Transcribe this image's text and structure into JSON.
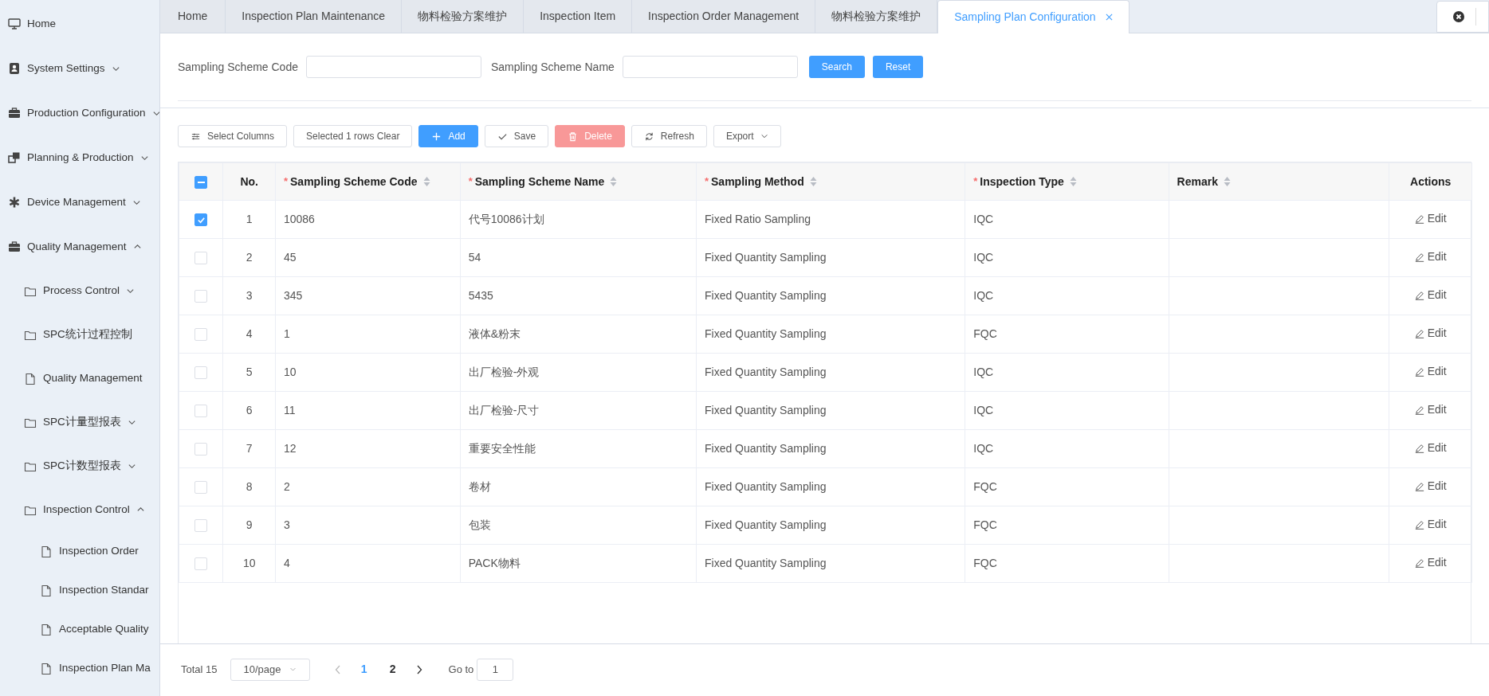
{
  "sidebar": {
    "items": [
      {
        "label": "Home",
        "kind": "menu"
      },
      {
        "label": "System Settings",
        "kind": "menu",
        "expanded": false
      },
      {
        "label": "Production Configuration",
        "kind": "menu",
        "expanded": false
      },
      {
        "label": "Planning & Production",
        "kind": "menu",
        "expanded": false
      },
      {
        "label": "Device Management",
        "kind": "menu",
        "expanded": false
      },
      {
        "label": "Quality Management",
        "kind": "menu",
        "expanded": true,
        "children": [
          {
            "label": "Process Control",
            "kind": "folder",
            "expanded": false
          },
          {
            "label": "SPC统计过程控制",
            "kind": "folder"
          },
          {
            "label": "Quality Management",
            "kind": "file"
          },
          {
            "label": "SPC计量型报表",
            "kind": "folder",
            "expanded": false
          },
          {
            "label": "SPC计数型报表",
            "kind": "folder",
            "expanded": false
          },
          {
            "label": "Inspection Control",
            "kind": "folder",
            "expanded": true,
            "children": [
              {
                "label": "Inspection Order",
                "kind": "file"
              },
              {
                "label": "Inspection Standar",
                "kind": "file"
              },
              {
                "label": "Acceptable Quality",
                "kind": "file"
              },
              {
                "label": "Inspection Plan Ma",
                "kind": "file"
              }
            ]
          }
        ]
      }
    ]
  },
  "tabs": [
    {
      "label": "Home",
      "selected": false
    },
    {
      "label": "Inspection Plan Maintenance",
      "selected": false
    },
    {
      "label": "物料检验方案维护",
      "selected": false
    },
    {
      "label": "Inspection Item",
      "selected": false
    },
    {
      "label": "Inspection Order Management",
      "selected": false
    },
    {
      "label": "物料检验方案维护",
      "selected": false
    },
    {
      "label": "Sampling Plan Configuration",
      "selected": true,
      "closable": true
    }
  ],
  "search": {
    "fields": [
      {
        "label": "Sampling Scheme Code"
      },
      {
        "label": "Sampling Scheme Name"
      }
    ],
    "buttons": [
      "Search",
      "Reset"
    ]
  },
  "toolbar": [
    {
      "kind": "columns",
      "label": "Select Columns"
    },
    {
      "kind": "plain",
      "label": "Selected 1 rows Clear"
    },
    {
      "kind": "add",
      "label": "Add"
    },
    {
      "kind": "save",
      "label": "Save"
    },
    {
      "kind": "delete",
      "label": "Delete"
    },
    {
      "kind": "refresh",
      "label": "Refresh"
    },
    {
      "kind": "export",
      "label": "Export"
    }
  ],
  "table": {
    "select_all": {
      "indeterminate": true
    },
    "columns": [
      {
        "label": "No.",
        "sortable": false
      },
      {
        "required_mark": "*",
        "label": "Sampling Scheme Code",
        "sortable": true
      },
      {
        "required_mark": "*",
        "label": "Sampling Scheme Name",
        "sortable": true
      },
      {
        "required_mark": "*",
        "label": "Sampling Method",
        "sortable": true
      },
      {
        "required_mark": "*",
        "label": "Inspection Type",
        "sortable": true
      },
      {
        "label": "Remark",
        "sortable": true
      },
      {
        "label": "Actions",
        "sortable": false
      }
    ],
    "rows": [
      {
        "selected": true,
        "no": "1",
        "code": "10086",
        "name": "代号10086计划",
        "method": "Fixed Ratio Sampling",
        "type": "IQC",
        "action": "Edit"
      },
      {
        "selected": false,
        "no": "2",
        "code": "45",
        "name": "54",
        "method": "Fixed Quantity Sampling",
        "type": "IQC",
        "action": "Edit"
      },
      {
        "selected": false,
        "no": "3",
        "code": "345",
        "name": "5435",
        "method": "Fixed Quantity Sampling",
        "type": "IQC",
        "action": "Edit"
      },
      {
        "selected": false,
        "no": "4",
        "code": "1",
        "name": "液体&粉末",
        "method": "Fixed Quantity Sampling",
        "type": "FQC",
        "action": "Edit"
      },
      {
        "selected": false,
        "no": "5",
        "code": "10",
        "name": "出厂检验-外观",
        "method": "Fixed Quantity Sampling",
        "type": "IQC",
        "action": "Edit"
      },
      {
        "selected": false,
        "no": "6",
        "code": "11",
        "name": "出厂检验-尺寸",
        "method": "Fixed Quantity Sampling",
        "type": "IQC",
        "action": "Edit"
      },
      {
        "selected": false,
        "no": "7",
        "code": "12",
        "name": "重要安全性能",
        "method": "Fixed Quantity Sampling",
        "type": "IQC",
        "action": "Edit"
      },
      {
        "selected": false,
        "no": "8",
        "code": "2",
        "name": "卷材",
        "method": "Fixed Quantity Sampling",
        "type": "FQC",
        "action": "Edit"
      },
      {
        "selected": false,
        "no": "9",
        "code": "3",
        "name": "包装",
        "method": "Fixed Quantity Sampling",
        "type": "FQC",
        "action": "Edit"
      },
      {
        "selected": false,
        "no": "10",
        "code": "4",
        "name": "PACK物料",
        "method": "Fixed Quantity Sampling",
        "type": "FQC",
        "action": "Edit"
      }
    ]
  },
  "pagination": {
    "total": "Total 15",
    "page_size": "10/page",
    "pages": [
      {
        "label": "1",
        "selected": true
      },
      {
        "label": "2",
        "selected": false
      }
    ],
    "goto_label": "Go to",
    "goto_value": "1"
  }
}
